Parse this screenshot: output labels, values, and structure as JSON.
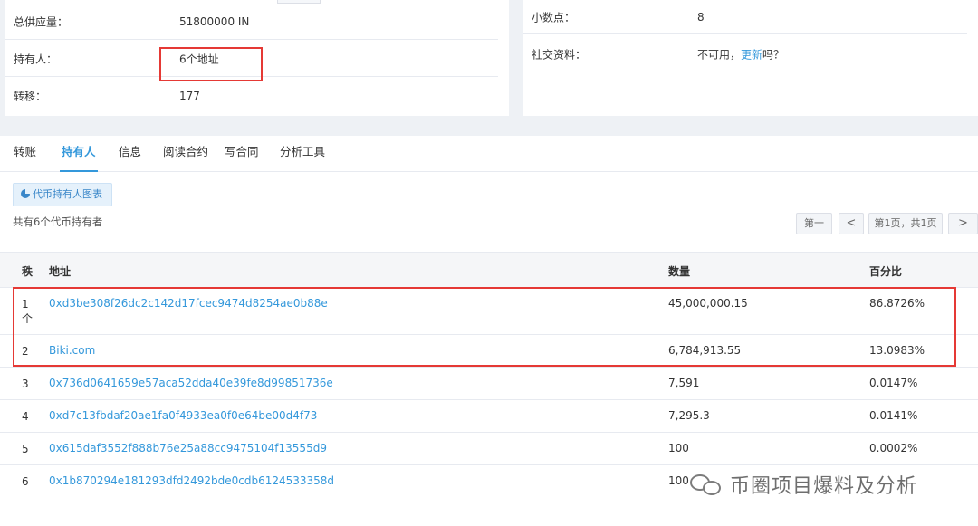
{
  "token_info_left": [
    {
      "label": "总供应量：",
      "value": "51800000 IN"
    },
    {
      "label": "持有人：",
      "value": "6个地址"
    },
    {
      "label": "转移：",
      "value": "177"
    }
  ],
  "token_info_right": {
    "decimals": {
      "label": "小数点：",
      "value": "8"
    },
    "social": {
      "label": "社交资料：",
      "value_prefix": "不可用，",
      "link": "更新",
      "value_suffix": "吗？"
    }
  },
  "tabs": [
    {
      "label": "转账",
      "active": false
    },
    {
      "label": "持有人",
      "active": true
    },
    {
      "label": "信息",
      "active": false
    },
    {
      "label": "阅读合约",
      "active": false
    },
    {
      "label": "写合同",
      "active": false
    },
    {
      "label": "分析工具",
      "active": false
    }
  ],
  "chart_button": "代币持有人图表",
  "holder_count": "共有6个代币持有者",
  "pagination": {
    "first": "第一",
    "prev": "<",
    "page_info": "第1页，共1页",
    "next": ">"
  },
  "table": {
    "headers": {
      "rank": "秩",
      "address": "地址",
      "quantity": "数量",
      "percent": "百分比"
    },
    "rows": [
      {
        "rank": "1 个",
        "address": "0xd3be308f26dc2c142d17fcec9474d8254ae0b88e",
        "quantity": "45,000,000.15",
        "percent": "86.8726%"
      },
      {
        "rank": "2",
        "address": "Biki.com",
        "quantity": "6,784,913.55",
        "percent": "13.0983%"
      },
      {
        "rank": "3",
        "address": "0x736d0641659e57aca52dda40e39fe8d99851736e",
        "quantity": "7,591",
        "percent": "0.0147%"
      },
      {
        "rank": "4",
        "address": "0xd7c13fbdaf20ae1fa0f4933ea0f0e64be00d4f73",
        "quantity": "7,295.3",
        "percent": "0.0141%"
      },
      {
        "rank": "5",
        "address": "0x615daf3552f888b76e25a88cc9475104f13555d9",
        "quantity": "100",
        "percent": "0.0002%"
      },
      {
        "rank": "6",
        "address": "0x1b870294e181293dfd2492bde0cdb6124533358d",
        "quantity": "100",
        "percent": ""
      }
    ]
  },
  "watermark": "币圈项目爆料及分析",
  "colors": {
    "link": "#3498db",
    "highlight": "#e53935",
    "accent_bg": "#e5f1fb"
  }
}
